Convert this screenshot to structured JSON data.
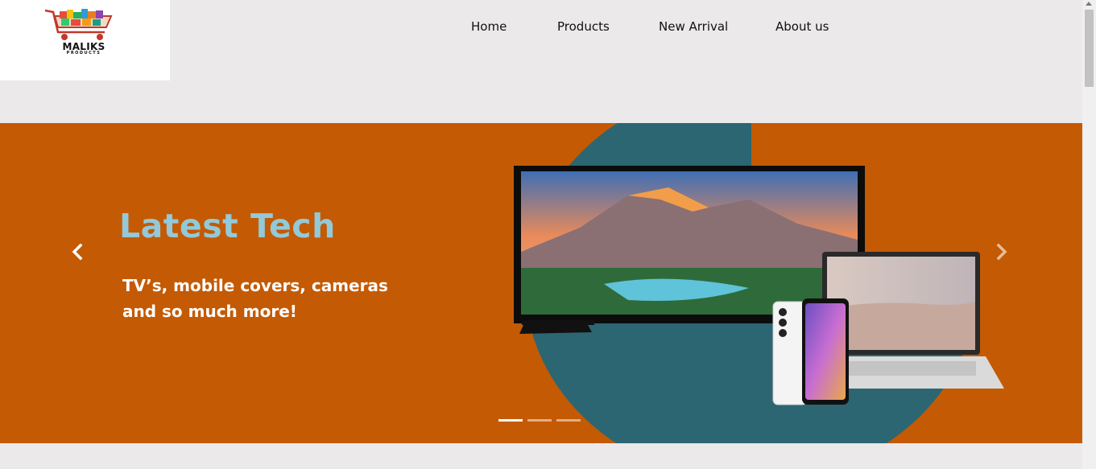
{
  "logo": {
    "name": "MALIKS",
    "tagline": "PRODUCTS"
  },
  "nav": {
    "items": [
      {
        "label": "Home"
      },
      {
        "label": "Products"
      },
      {
        "label": "New Arrival"
      },
      {
        "label": "About us"
      }
    ]
  },
  "hero": {
    "title": "Latest Tech",
    "subtitle": "TV’s, mobile covers, cameras and so much more!",
    "active_slide": 1,
    "slide_count": 3,
    "colors": {
      "background": "#c45a04",
      "circle": "#2b6672",
      "title": "#93c9d8",
      "subtitle": "#ffffff"
    }
  },
  "controls": {
    "prev_icon": "chevron-left-icon",
    "next_icon": "chevron-right-icon"
  }
}
